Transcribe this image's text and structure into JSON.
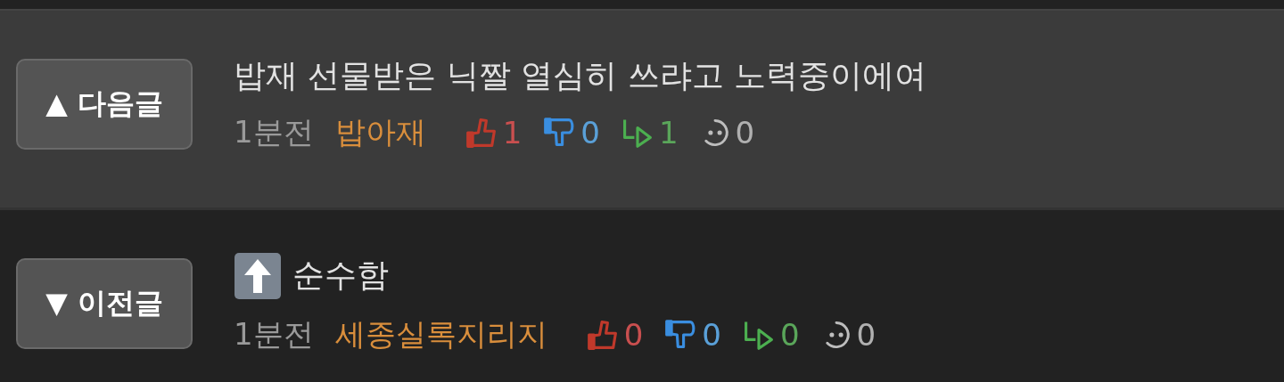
{
  "posts": [
    {
      "selected": true,
      "nav_button": "▲ 다음글",
      "title_icon": false,
      "title": "밥재 선물받은 닉짤 열심히 쓰랴고 노력중이에여",
      "time": "1분전",
      "author": "밥아재",
      "stats": [
        {
          "kind": "up",
          "count": "1"
        },
        {
          "kind": "down",
          "count": "0"
        },
        {
          "kind": "reply",
          "count": "1"
        },
        {
          "kind": "comment",
          "count": "0"
        }
      ]
    },
    {
      "selected": false,
      "nav_button": "▼ 이전글",
      "title_icon": true,
      "title": "순수함",
      "time": "1분전",
      "author": "세종실록지리지",
      "stats": [
        {
          "kind": "up",
          "count": "0"
        },
        {
          "kind": "down",
          "count": "0"
        },
        {
          "kind": "reply",
          "count": "0"
        },
        {
          "kind": "comment",
          "count": "0"
        }
      ]
    }
  ]
}
